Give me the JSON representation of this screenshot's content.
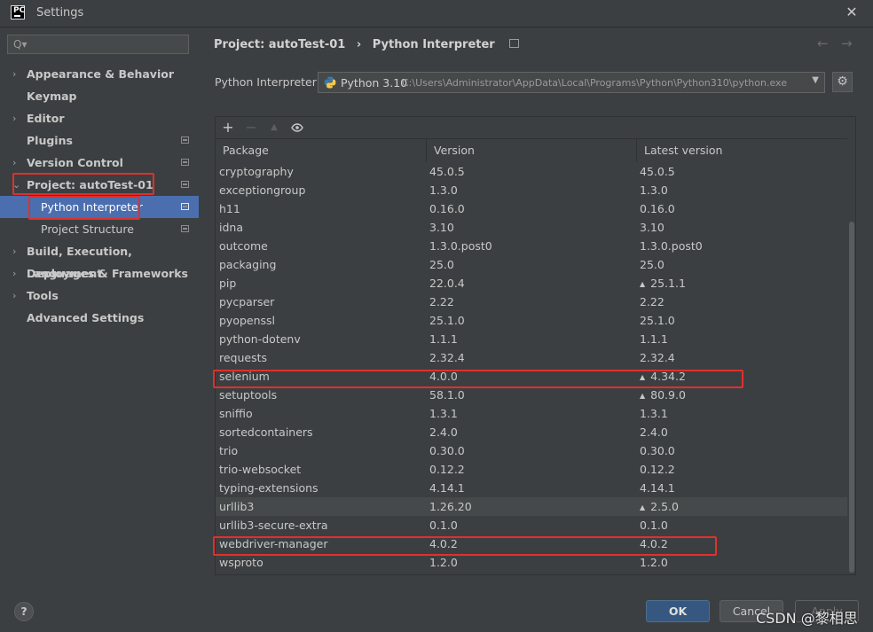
{
  "window": {
    "title": "Settings",
    "logo": "PC",
    "close_glyph": "✕"
  },
  "sidebar": {
    "search_placeholder": "Q▾",
    "items": [
      {
        "label": "Appearance & Behavior",
        "arrow": "›"
      },
      {
        "label": "Keymap"
      },
      {
        "label": "Editor",
        "arrow": "›"
      },
      {
        "label": "Plugins"
      },
      {
        "label": "Version Control",
        "arrow": "›"
      },
      {
        "label": "Project: autoTest-01",
        "arrow": "⌄"
      },
      {
        "label": "Python Interpreter"
      },
      {
        "label": "Project Structure"
      },
      {
        "label": "Build, Execution, Deployment",
        "arrow": "›"
      },
      {
        "label": "Languages & Frameworks",
        "arrow": "›"
      },
      {
        "label": "Tools",
        "arrow": "›"
      },
      {
        "label": "Advanced Settings"
      }
    ]
  },
  "breadcrumb": {
    "project": "Project: autoTest-01",
    "separator": "›",
    "page": "Python Interpreter"
  },
  "nav": {
    "back": "←",
    "forward": "→"
  },
  "interpreter": {
    "label": "Python Interpreter:",
    "name": "Python 3.10",
    "path": "C:\\Users\\Administrator\\AppData\\Local\\Programs\\Python\\Python310\\python.exe",
    "caret": "▼",
    "settings_glyph": "⚙"
  },
  "toolbar": {
    "add": "+",
    "remove": "−",
    "upgrade": "▲",
    "show": "👁"
  },
  "table": {
    "headers": {
      "package": "Package",
      "version": "Version",
      "latest": "Latest version"
    },
    "rows": [
      {
        "package": "cryptography",
        "version": "45.0.5",
        "latest": "45.0.5",
        "upgrade": false
      },
      {
        "package": "exceptiongroup",
        "version": "1.3.0",
        "latest": "1.3.0",
        "upgrade": false
      },
      {
        "package": "h11",
        "version": "0.16.0",
        "latest": "0.16.0",
        "upgrade": false
      },
      {
        "package": "idna",
        "version": "3.10",
        "latest": "3.10",
        "upgrade": false
      },
      {
        "package": "outcome",
        "version": "1.3.0.post0",
        "latest": "1.3.0.post0",
        "upgrade": false
      },
      {
        "package": "packaging",
        "version": "25.0",
        "latest": "25.0",
        "upgrade": false
      },
      {
        "package": "pip",
        "version": "22.0.4",
        "latest": "25.1.1",
        "upgrade": true
      },
      {
        "package": "pycparser",
        "version": "2.22",
        "latest": "2.22",
        "upgrade": false
      },
      {
        "package": "pyopenssl",
        "version": "25.1.0",
        "latest": "25.1.0",
        "upgrade": false
      },
      {
        "package": "python-dotenv",
        "version": "1.1.1",
        "latest": "1.1.1",
        "upgrade": false
      },
      {
        "package": "requests",
        "version": "2.32.4",
        "latest": "2.32.4",
        "upgrade": false
      },
      {
        "package": "selenium",
        "version": "4.0.0",
        "latest": "4.34.2",
        "upgrade": true
      },
      {
        "package": "setuptools",
        "version": "58.1.0",
        "latest": "80.9.0",
        "upgrade": true
      },
      {
        "package": "sniffio",
        "version": "1.3.1",
        "latest": "1.3.1",
        "upgrade": false
      },
      {
        "package": "sortedcontainers",
        "version": "2.4.0",
        "latest": "2.4.0",
        "upgrade": false
      },
      {
        "package": "trio",
        "version": "0.30.0",
        "latest": "0.30.0",
        "upgrade": false
      },
      {
        "package": "trio-websocket",
        "version": "0.12.2",
        "latest": "0.12.2",
        "upgrade": false
      },
      {
        "package": "typing-extensions",
        "version": "4.14.1",
        "latest": "4.14.1",
        "upgrade": false
      },
      {
        "package": "urllib3",
        "version": "1.26.20",
        "latest": "2.5.0",
        "upgrade": true
      },
      {
        "package": "urllib3-secure-extra",
        "version": "0.1.0",
        "latest": "0.1.0",
        "upgrade": false
      },
      {
        "package": "webdriver-manager",
        "version": "4.0.2",
        "latest": "4.0.2",
        "upgrade": false
      },
      {
        "package": "wsproto",
        "version": "1.2.0",
        "latest": "1.2.0",
        "upgrade": false
      }
    ]
  },
  "footer": {
    "help": "?",
    "ok": "OK",
    "cancel": "Cancel",
    "apply": "Apply"
  },
  "watermark": "CSDN @黎相思",
  "colors": {
    "accent": "#4b6eaf",
    "annotation": "#e0302c",
    "ok_button": "#365880",
    "background": "#3c3f41"
  }
}
